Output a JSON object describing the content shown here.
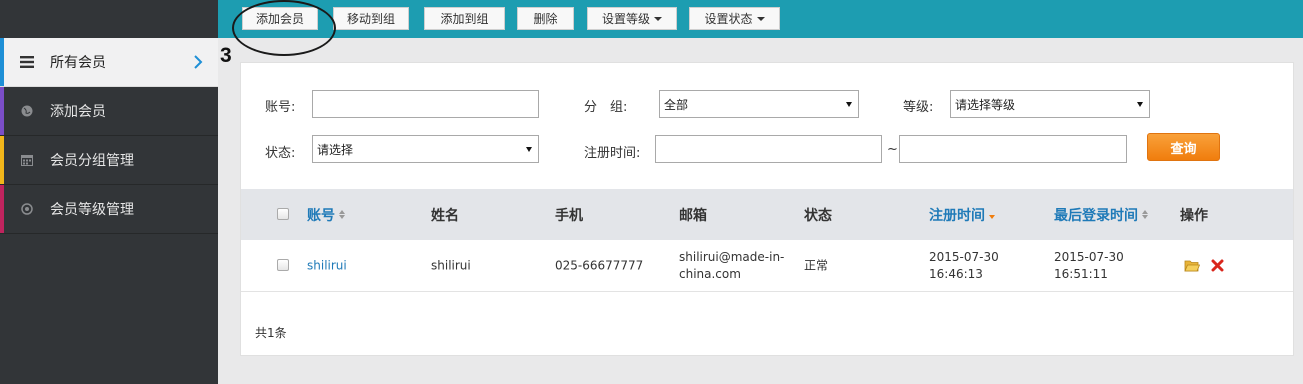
{
  "sidebar": {
    "items": [
      {
        "label": "所有会员",
        "icon": "list-icon",
        "bar_color": "#1e8fd6",
        "active": true
      },
      {
        "label": "添加会员",
        "icon": "globe-icon",
        "bar_color": "#7b4ec8"
      },
      {
        "label": "会员分组管理",
        "icon": "calendar-icon",
        "bar_color": "#f2b61a"
      },
      {
        "label": "会员等级管理",
        "icon": "target-icon",
        "bar_color": "#c0245e"
      }
    ]
  },
  "toolbar": {
    "add_member": "添加会员",
    "move_to_group": "移动到组",
    "add_to_group": "添加到组",
    "delete": "删除",
    "set_level": "设置等级",
    "set_status": "设置状态"
  },
  "annotation": {
    "step": "3"
  },
  "filters": {
    "account_label": "账号:",
    "account_value": "",
    "group_label": "分　组:",
    "group_value": "全部",
    "level_label": "等级:",
    "level_value": "请选择等级",
    "status_label": "状态:",
    "status_value": "请选择",
    "regtime_label": "注册时间:",
    "regtime_sep": "~",
    "query_button": "查询"
  },
  "table": {
    "headers": {
      "account": "账号",
      "name": "姓名",
      "phone": "手机",
      "email": "邮箱",
      "status": "状态",
      "reg_time": "注册时间",
      "last_login": "最后登录时间",
      "actions": "操作"
    },
    "rows": [
      {
        "account": "shilirui",
        "name": "shilirui",
        "phone": "025-66677777",
        "email_line1": "shilirui@made-in-",
        "email_line2": "china.com",
        "status": "正常",
        "reg_date": "2015-07-30",
        "reg_time": "16:46:13",
        "login_date": "2015-07-30",
        "login_time": "16:51:11"
      }
    ],
    "total": "共1条"
  },
  "colors": {
    "topbar": "#1d9db1",
    "sidebar": "#323538",
    "link": "#1f7ab8",
    "query_button": "#f07d0d"
  }
}
